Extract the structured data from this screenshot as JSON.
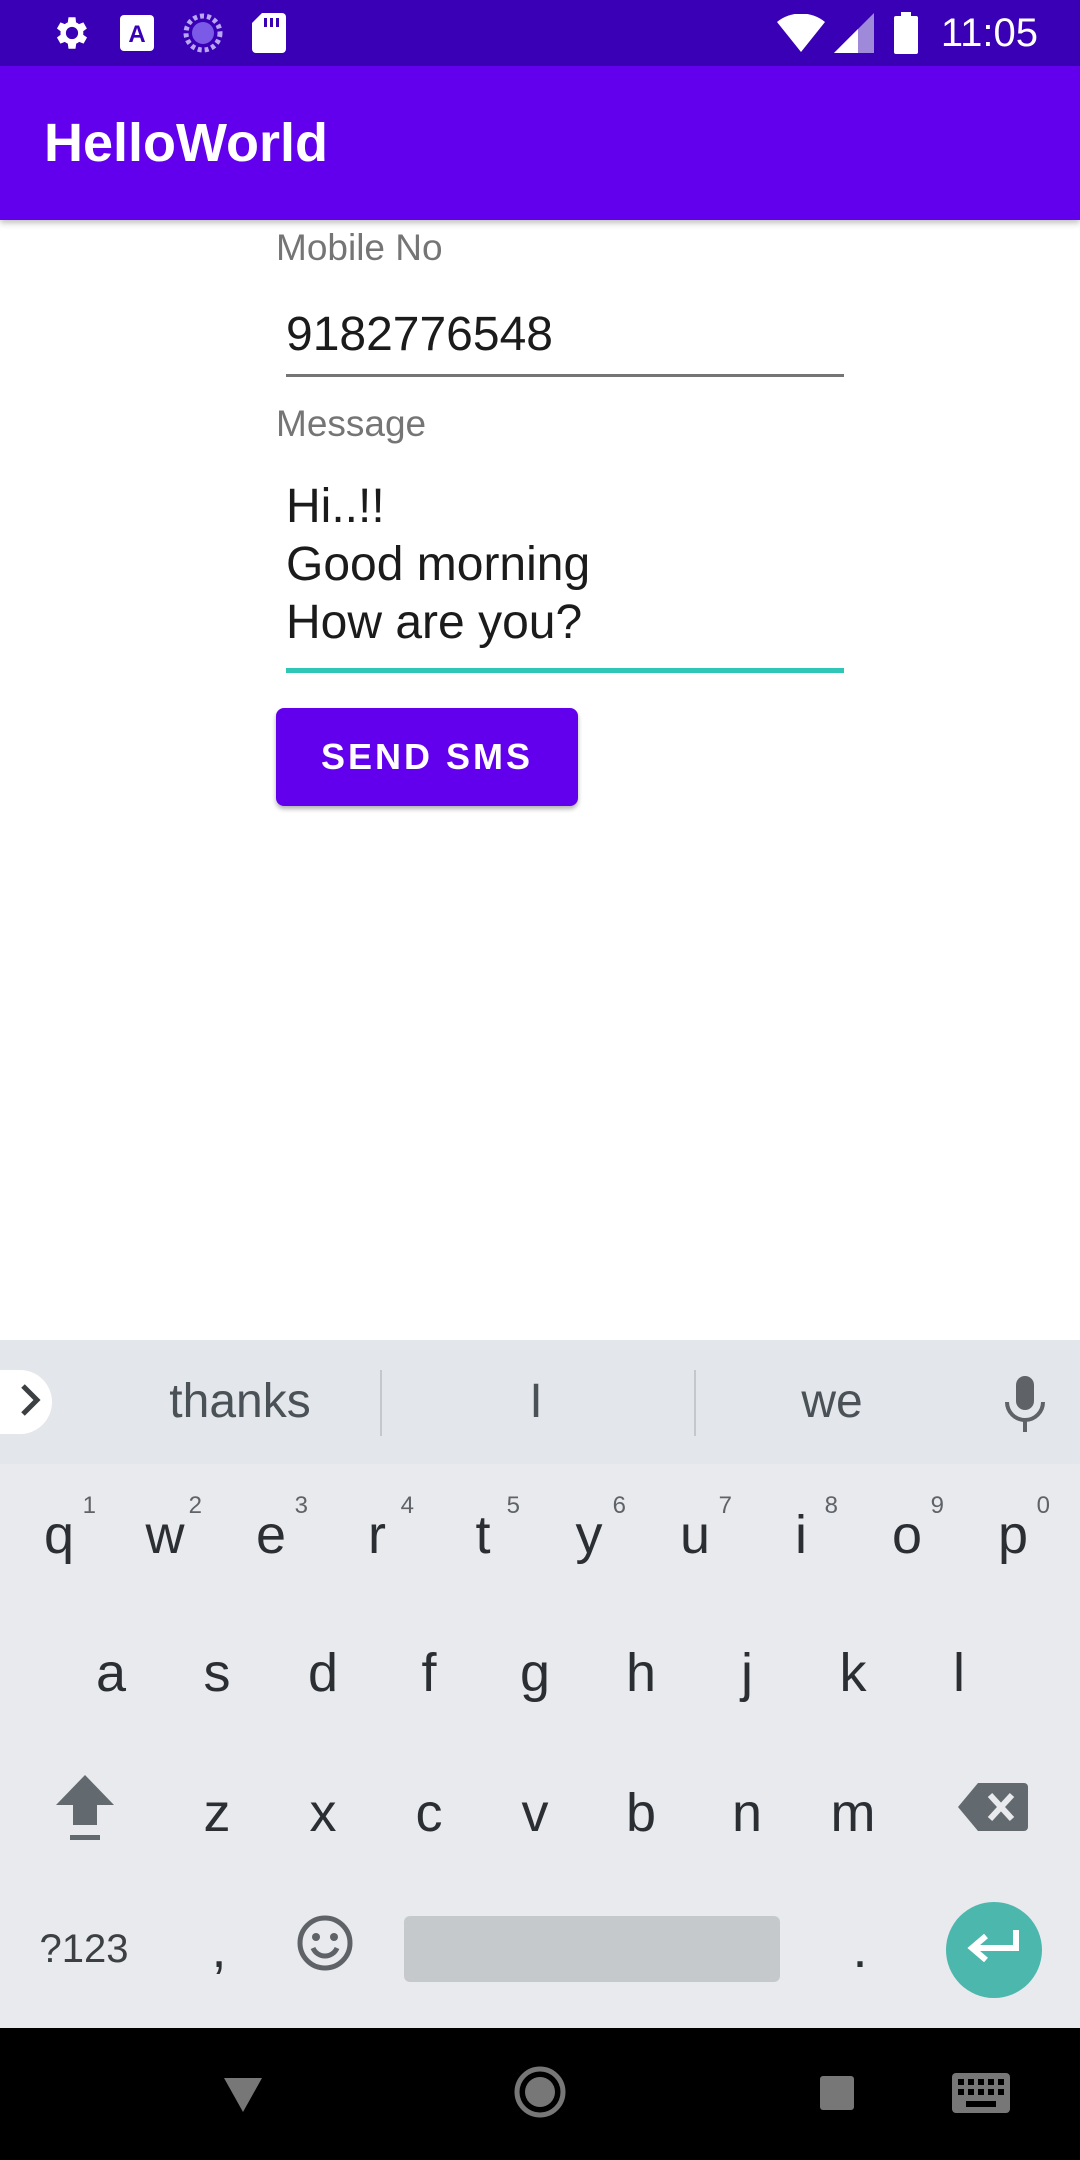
{
  "status_bar": {
    "time": "11:05",
    "icons_left": [
      "settings-icon",
      "font-a-icon",
      "loading-icon",
      "sd-card-icon"
    ],
    "icons_right": [
      "wifi-icon",
      "signal-icon",
      "battery-icon"
    ]
  },
  "app_bar": {
    "title": "HelloWorld"
  },
  "form": {
    "mobile_label": "Mobile No",
    "mobile_value": "9182776548",
    "message_label": "Message",
    "message_value": "Hi..!!\nGood morning\nHow are you?",
    "send_button": "SEND SMS"
  },
  "keyboard": {
    "suggestions": [
      "thanks",
      "I",
      "we"
    ],
    "row1": [
      "q",
      "w",
      "e",
      "r",
      "t",
      "y",
      "u",
      "i",
      "o",
      "p"
    ],
    "row1_hints": [
      "1",
      "2",
      "3",
      "4",
      "5",
      "6",
      "7",
      "8",
      "9",
      "0"
    ],
    "row2": [
      "a",
      "s",
      "d",
      "f",
      "g",
      "h",
      "j",
      "k",
      "l"
    ],
    "row3": [
      "z",
      "x",
      "c",
      "v",
      "b",
      "n",
      "m"
    ],
    "symbols_key": "?123",
    "comma_key": ",",
    "period_key": "."
  },
  "colors": {
    "status_bar": "#3a00b5",
    "app_bar": "#6200ee",
    "accent": "#2fc6b8",
    "button": "#6200ee",
    "keyboard_bg": "#e8eaed"
  }
}
